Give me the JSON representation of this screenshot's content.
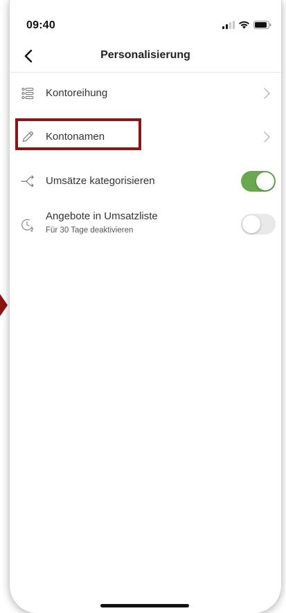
{
  "status_bar": {
    "time": "09:40"
  },
  "nav": {
    "title": "Personalisierung",
    "back_icon": "chevron-left-icon"
  },
  "settings": [
    {
      "label": "Kontoreihung",
      "icon": "list-order-icon",
      "control": "chevron"
    },
    {
      "label": "Kontonamen",
      "icon": "pencil-icon",
      "control": "chevron"
    },
    {
      "label": "Umsätze kategorisieren",
      "icon": "branch-arrow-icon",
      "control": "toggle",
      "value": true
    },
    {
      "label": "Angebote in Umsatzliste",
      "sublabel": "Für 30 Tage deaktivieren",
      "icon": "clock-snooze-icon",
      "control": "toggle",
      "value": false
    }
  ],
  "colors": {
    "toggle_on": "#6aa84f",
    "toggle_off": "#e9e9eb",
    "highlight": "#8b1414"
  }
}
